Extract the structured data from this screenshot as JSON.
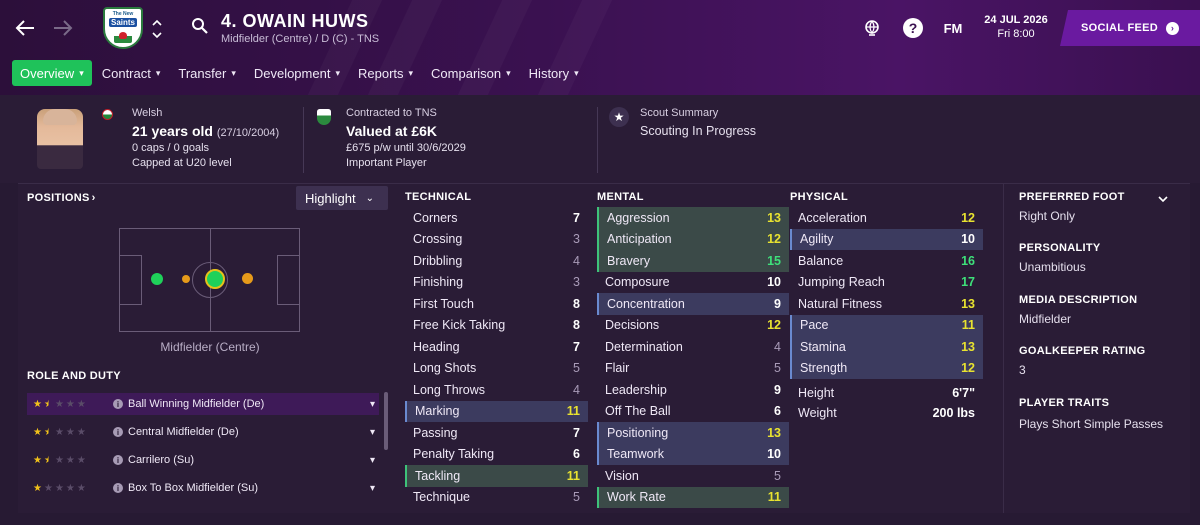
{
  "header": {
    "club_crest": {
      "top_text": "The New",
      "name": "Saints"
    },
    "title": "4. OWAIN HUWS",
    "subtitle": "Midfielder (Centre) / D (C) - TNS",
    "help_label": "?",
    "fm_label": "FM",
    "date": "24 JUL 2026",
    "time": "Fri 8:00",
    "social_feed": "SOCIAL FEED",
    "icons": [
      "back-arrow-icon",
      "forward-arrow-icon",
      "search-icon",
      "globe-icon",
      "help-icon",
      "chevron-up-icon",
      "chevron-down-icon"
    ]
  },
  "nav": {
    "items": [
      {
        "label": "Overview",
        "active": true
      },
      {
        "label": "Contract",
        "active": false
      },
      {
        "label": "Transfer",
        "active": false
      },
      {
        "label": "Development",
        "active": false
      },
      {
        "label": "Reports",
        "active": false
      },
      {
        "label": "Comparison",
        "active": false
      },
      {
        "label": "History",
        "active": false
      }
    ],
    "chevron": "⌄"
  },
  "profile": {
    "nationality": "Welsh",
    "age": "21 years old",
    "dob": "(27/10/2004)",
    "caps": "0 caps / 0 goals",
    "capped": "Capped at U20 level",
    "contract_label": "Contracted to TNS",
    "value": "Valued at £6K",
    "wage": "£675 p/w until 30/6/2029",
    "status": "Important Player",
    "scout_label": "Scout Summary",
    "scout_status": "Scouting In Progress"
  },
  "positions": {
    "heading": "POSITIONS",
    "arrow": "›",
    "highlight_label": "Highlight",
    "highlight_chevron": "⌄",
    "position_label": "Midfielder (Centre)",
    "colors": {
      "green": "#1fd15a",
      "orange": "#e69a1a"
    }
  },
  "roles": {
    "heading": "ROLE AND DUTY",
    "items": [
      {
        "name": "Ball Winning Midfielder (De)",
        "stars": 1.5
      },
      {
        "name": "Central Midfielder (De)",
        "stars": 1.5
      },
      {
        "name": "Carrilero (Su)",
        "stars": 1.5
      },
      {
        "name": "Box To Box Midfielder (Su)",
        "stars": 1
      }
    ]
  },
  "technical": {
    "heading": "TECHNICAL",
    "attrs": [
      {
        "name": "Corners",
        "value": "7",
        "hl": ""
      },
      {
        "name": "Crossing",
        "value": "3",
        "hl": ""
      },
      {
        "name": "Dribbling",
        "value": "4",
        "hl": ""
      },
      {
        "name": "Finishing",
        "value": "3",
        "hl": ""
      },
      {
        "name": "First Touch",
        "value": "8",
        "hl": ""
      },
      {
        "name": "Free Kick Taking",
        "value": "8",
        "hl": ""
      },
      {
        "name": "Heading",
        "value": "7",
        "hl": ""
      },
      {
        "name": "Long Shots",
        "value": "5",
        "hl": ""
      },
      {
        "name": "Long Throws",
        "value": "4",
        "hl": ""
      },
      {
        "name": "Marking",
        "value": "11",
        "hl": "blue"
      },
      {
        "name": "Passing",
        "value": "7",
        "hl": ""
      },
      {
        "name": "Penalty Taking",
        "value": "6",
        "hl": ""
      },
      {
        "name": "Tackling",
        "value": "11",
        "hl": "green"
      },
      {
        "name": "Technique",
        "value": "5",
        "hl": ""
      }
    ]
  },
  "mental": {
    "heading": "MENTAL",
    "attrs": [
      {
        "name": "Aggression",
        "value": "13",
        "hl": "green"
      },
      {
        "name": "Anticipation",
        "value": "12",
        "hl": "green"
      },
      {
        "name": "Bravery",
        "value": "15",
        "hl": "green"
      },
      {
        "name": "Composure",
        "value": "10",
        "hl": ""
      },
      {
        "name": "Concentration",
        "value": "9",
        "hl": "blue"
      },
      {
        "name": "Decisions",
        "value": "12",
        "hl": ""
      },
      {
        "name": "Determination",
        "value": "4",
        "hl": ""
      },
      {
        "name": "Flair",
        "value": "5",
        "hl": ""
      },
      {
        "name": "Leadership",
        "value": "9",
        "hl": ""
      },
      {
        "name": "Off The Ball",
        "value": "6",
        "hl": ""
      },
      {
        "name": "Positioning",
        "value": "13",
        "hl": "blue"
      },
      {
        "name": "Teamwork",
        "value": "10",
        "hl": "blue"
      },
      {
        "name": "Vision",
        "value": "5",
        "hl": ""
      },
      {
        "name": "Work Rate",
        "value": "11",
        "hl": "green"
      }
    ]
  },
  "physical": {
    "heading": "PHYSICAL",
    "attrs": [
      {
        "name": "Acceleration",
        "value": "12",
        "hl": ""
      },
      {
        "name": "Agility",
        "value": "10",
        "hl": "blue"
      },
      {
        "name": "Balance",
        "value": "16",
        "hl": ""
      },
      {
        "name": "Jumping Reach",
        "value": "17",
        "hl": ""
      },
      {
        "name": "Natural Fitness",
        "value": "13",
        "hl": ""
      },
      {
        "name": "Pace",
        "value": "11",
        "hl": "blue"
      },
      {
        "name": "Stamina",
        "value": "13",
        "hl": "blue"
      },
      {
        "name": "Strength",
        "value": "12",
        "hl": "blue"
      }
    ],
    "height_label": "Height",
    "height": "6'7\"",
    "weight_label": "Weight",
    "weight": "200 lbs"
  },
  "details": {
    "foot_label": "PREFERRED FOOT",
    "foot": "Right Only",
    "personality_label": "PERSONALITY",
    "personality": "Unambitious",
    "media_label": "MEDIA DESCRIPTION",
    "media": "Midfielder",
    "gk_label": "GOALKEEPER RATING",
    "gk": "3",
    "traits_label": "PLAYER TRAITS",
    "traits": "Plays Short Simple Passes"
  }
}
